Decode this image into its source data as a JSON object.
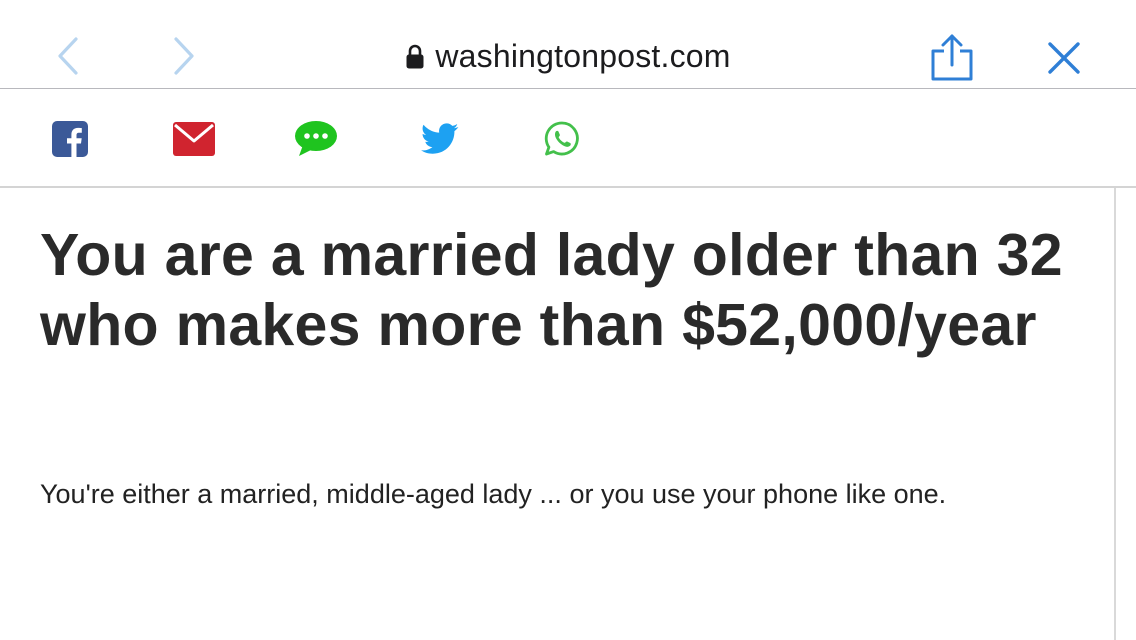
{
  "browser": {
    "url": "washingtonpost.com",
    "icons": {
      "back": "chevron-left-icon",
      "forward": "chevron-right-icon",
      "secure": "lock-icon",
      "share": "share-icon",
      "close": "close-icon"
    },
    "colors": {
      "accent": "#2f7fd6",
      "disabled_nav": "#b7d4ef"
    }
  },
  "share_bar": {
    "items": [
      {
        "name": "facebook",
        "icon": "facebook-icon",
        "color": "#3b5998"
      },
      {
        "name": "email",
        "icon": "envelope-icon",
        "color": "#d0242f"
      },
      {
        "name": "sms",
        "icon": "speech-bubble-icon",
        "color": "#1fc41f"
      },
      {
        "name": "twitter",
        "icon": "twitter-bird-icon",
        "color": "#1da1f2"
      },
      {
        "name": "whatsapp",
        "icon": "whatsapp-icon",
        "color": "#43c04b"
      }
    ]
  },
  "article": {
    "headline": "You are a married lady older than 32 who makes more than $52,000/year",
    "dek": "You're either a married, middle-aged lady ... or you use your phone like one."
  }
}
